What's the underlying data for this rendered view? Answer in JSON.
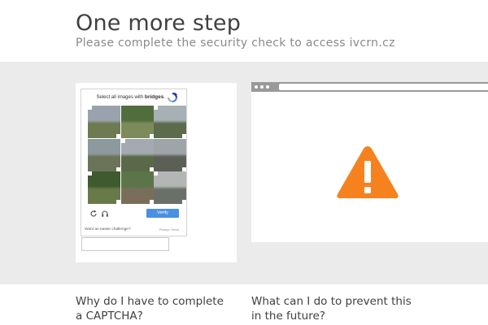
{
  "header": {
    "title": "One more step",
    "subtitle": "Please complete the security check to access ivcrn.cz"
  },
  "captcha": {
    "prompt_prefix": "Select all images with",
    "prompt_target": "bridges",
    "verify_label": "Verify",
    "easier_label": "Want an easier challenge?",
    "privacy_label": "Privacy • Terms",
    "response_value": "",
    "tiles": [
      {
        "top": "#9aa3ad",
        "bottom": "#6d7a52"
      },
      {
        "top": "#4f6e3c",
        "bottom": "#7c8a5c"
      },
      {
        "top": "#a7b0b4",
        "bottom": "#5d6b4d"
      },
      {
        "top": "#8c9a9e",
        "bottom": "#6b7458"
      },
      {
        "top": "#a3aab0",
        "bottom": "#5a6948"
      },
      {
        "top": "#9ea5a8",
        "bottom": "#5c5f55"
      },
      {
        "top": "#3e5a2e",
        "bottom": "#697a4a"
      },
      {
        "top": "#5c7449",
        "bottom": "#7a6e5a"
      },
      {
        "top": "#b3b6b4",
        "bottom": "#6b6f6a"
      }
    ]
  },
  "colors": {
    "warning": "#f6821f",
    "band": "#ebebeb",
    "verify": "#4a90e2"
  },
  "faq": {
    "q1": "Why do I have to complete a CAPTCHA?",
    "q2": "What can I do to prevent this in the future?"
  }
}
